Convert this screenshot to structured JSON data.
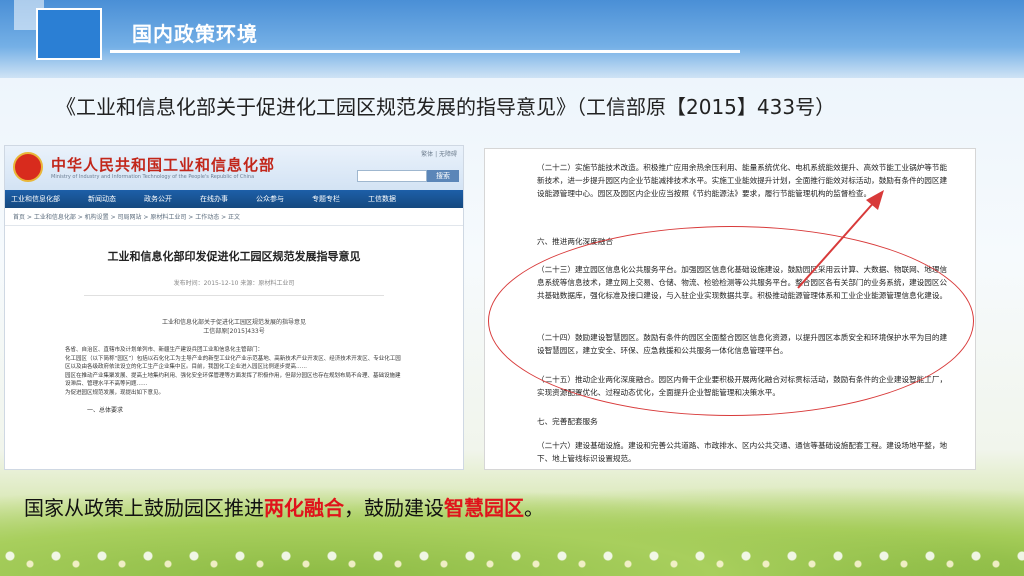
{
  "header": {
    "section_title": "国内政策环境"
  },
  "headline": "《工业和信息化部关于促进化工园区规范发展的指导意见》（工信部原【2015】433号）",
  "ministry_page": {
    "site_name": "中华人民共和国工业和信息化部",
    "site_name_en": "Ministry of Industry and Information Technology of the People's Republic of China",
    "top_links": "繁体 | 无障碍",
    "search_button": "搜索",
    "nav": [
      "工业和信息化部",
      "新闻动态",
      "政务公开",
      "在线办事",
      "公众参与",
      "专题专栏",
      "工信数据"
    ],
    "breadcrumb": "首页 > 工业和信息化部 > 机构设置 > 司局网站 > 原材料工业司 > 工作动态 > 正文",
    "doc_title": "工业和信息化部印发促进化工园区规范发展指导意见",
    "doc_meta": "发布时间：2015-12-10   来源：原材料工业司",
    "doc_sub_1": "工业和信息化部关于促进化工园区规范发展的指导意见",
    "doc_sub_2": "工信部原[2015]433号",
    "doc_body": [
      "各省、自治区、直辖市及计划单列市、新疆生产建设兵团工业和信息化主管部门：",
      "化工园区（以下简称“园区”）包括以石化化工为主导产业的新型工业化产业示范基地、高新技术产业开发区、经济技术开发区、专业化工园区以及由各级政府依法设立的化工生产企业集中区。目前，我国化工企业进入园区比例逐步提高……",
      "园区在推动产业集聚发展、提高土地集约利用、强化安全环保管理等方面发挥了积极作用，但部分园区也存在规划布局不合理、基础设施建设滞后、管理水平不高等问题……",
      "为促进园区规范发展，现提出如下意见。"
    ],
    "doc_section": "一、总体要求"
  },
  "excerpt": {
    "p22": "（二十二）实施节能技术改造。积极推广应用余热余压利用、能量系统优化、电机系统能效提升、高效节能工业锅炉等节能新技术，进一步提升园区内企业节能减排技术水平。实施工业能效提升计划，全面推行能效对标活动，鼓励有条件的园区建设能源管理中心。园区及园区内企业应当按照《节约能源法》要求，履行节能管理机构的监督检查。",
    "sec6": "六、推进两化深度融合",
    "p23": "（二十三）建立园区信息化公共服务平台。加强园区信息化基础设施建设，鼓励园区采用云计算、大数据、物联网、地理信息系统等信息技术，建立网上交易、仓储、物流、检验检测等公共服务平台。整合园区各有关部门的业务系统，建设园区公共基础数据库，强化标准及接口建设，与入驻企业实现数据共享。积极推动能源管理体系和工业企业能源管理信息化建设。",
    "p24": "（二十四）鼓励建设智慧园区。鼓励有条件的园区全面整合园区信息化资源，以提升园区本质安全和环境保护水平为目的建设智慧园区，建立安全、环保、应急救援和公共服务一体化信息管理平台。",
    "p25": "（二十五）推动企业两化深度融合。园区内骨干企业要积极开展两化融合对标贯标活动，鼓励有条件的企业建设智能工厂，实现资源配置优化、过程动态优化，全面提升企业智能管理和决策水平。",
    "sec7": "七、完善配套服务",
    "p26": "（二十六）建设基础设施。建设和完善公共道路、市政排水、区内公共交通、通信等基础设施配套工程。建设场地平整，地下、地上管线标识设置规范。"
  },
  "caption": {
    "part1": "国家从政策上鼓励园区推进",
    "hl1": "两化融合",
    "part2": "，鼓励建设",
    "hl2": "智慧园区",
    "part3": "。"
  },
  "colors": {
    "accent": "#2b7fd4",
    "highlight": "#e0131b",
    "annotation": "#d83a3a"
  }
}
